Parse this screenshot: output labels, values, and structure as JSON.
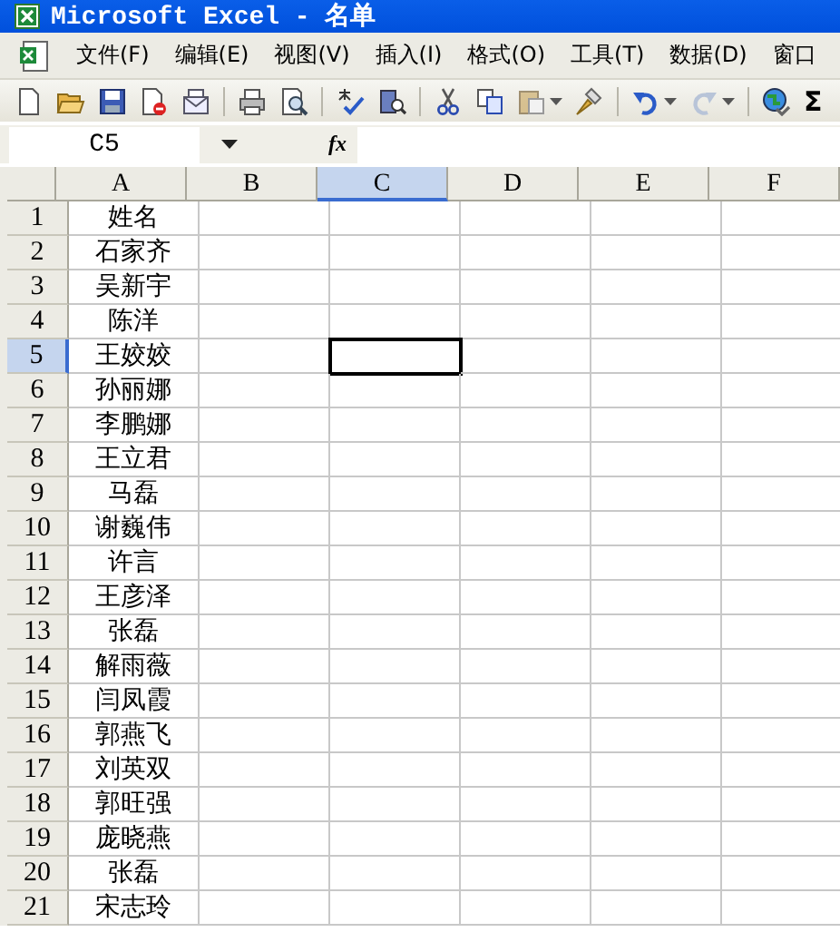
{
  "window": {
    "title": "Microsoft Excel - 名单"
  },
  "menu": [
    {
      "label": "文件(F)"
    },
    {
      "label": "编辑(E)"
    },
    {
      "label": "视图(V)"
    },
    {
      "label": "插入(I)"
    },
    {
      "label": "格式(O)"
    },
    {
      "label": "工具(T)"
    },
    {
      "label": "数据(D)"
    },
    {
      "label": "窗口"
    }
  ],
  "toolbar": [
    {
      "kind": "new"
    },
    {
      "kind": "open"
    },
    {
      "kind": "save"
    },
    {
      "kind": "permission"
    },
    {
      "kind": "mail"
    },
    {
      "kind": "sep"
    },
    {
      "kind": "print"
    },
    {
      "kind": "preview"
    },
    {
      "kind": "sep"
    },
    {
      "kind": "spell"
    },
    {
      "kind": "research"
    },
    {
      "kind": "sep"
    },
    {
      "kind": "cut"
    },
    {
      "kind": "copy"
    },
    {
      "kind": "paste"
    },
    {
      "kind": "drop"
    },
    {
      "kind": "painter"
    },
    {
      "kind": "sep"
    },
    {
      "kind": "undo"
    },
    {
      "kind": "drop"
    },
    {
      "kind": "redo"
    },
    {
      "kind": "drop"
    },
    {
      "kind": "sep"
    },
    {
      "kind": "link"
    },
    {
      "kind": "sum",
      "text": "Σ"
    }
  ],
  "formula_bar": {
    "name_box": "C5",
    "fx": "fx"
  },
  "columns": [
    {
      "label": "A",
      "selected": false
    },
    {
      "label": "B",
      "selected": false
    },
    {
      "label": "C",
      "selected": true
    },
    {
      "label": "D",
      "selected": false
    },
    {
      "label": "E",
      "selected": false
    },
    {
      "label": "F",
      "selected": false
    }
  ],
  "rows": [
    {
      "number": "1",
      "name": "姓名",
      "selected": false
    },
    {
      "number": "2",
      "name": "石家齐",
      "selected": false
    },
    {
      "number": "3",
      "name": "吴新宇",
      "selected": false
    },
    {
      "number": "4",
      "name": "陈洋",
      "selected": false
    },
    {
      "number": "5",
      "name": "王姣姣",
      "selected": true
    },
    {
      "number": "6",
      "name": "孙丽娜",
      "selected": false
    },
    {
      "number": "7",
      "name": "李鹏娜",
      "selected": false
    },
    {
      "number": "8",
      "name": "王立君",
      "selected": false
    },
    {
      "number": "9",
      "name": "马磊",
      "selected": false
    },
    {
      "number": "10",
      "name": "谢巍伟",
      "selected": false
    },
    {
      "number": "11",
      "name": "许言",
      "selected": false
    },
    {
      "number": "12",
      "name": "王彦泽",
      "selected": false
    },
    {
      "number": "13",
      "name": "张磊",
      "selected": false
    },
    {
      "number": "14",
      "name": "解雨薇",
      "selected": false
    },
    {
      "number": "15",
      "name": "闫凤霞",
      "selected": false
    },
    {
      "number": "16",
      "name": "郭燕飞",
      "selected": false
    },
    {
      "number": "17",
      "name": "刘英双",
      "selected": false
    },
    {
      "number": "18",
      "name": "郭旺强",
      "selected": false
    },
    {
      "number": "19",
      "name": "庞晓燕",
      "selected": false
    },
    {
      "number": "20",
      "name": "张磊",
      "selected": false
    },
    {
      "number": "21",
      "name": "宋志玲",
      "selected": false
    }
  ]
}
